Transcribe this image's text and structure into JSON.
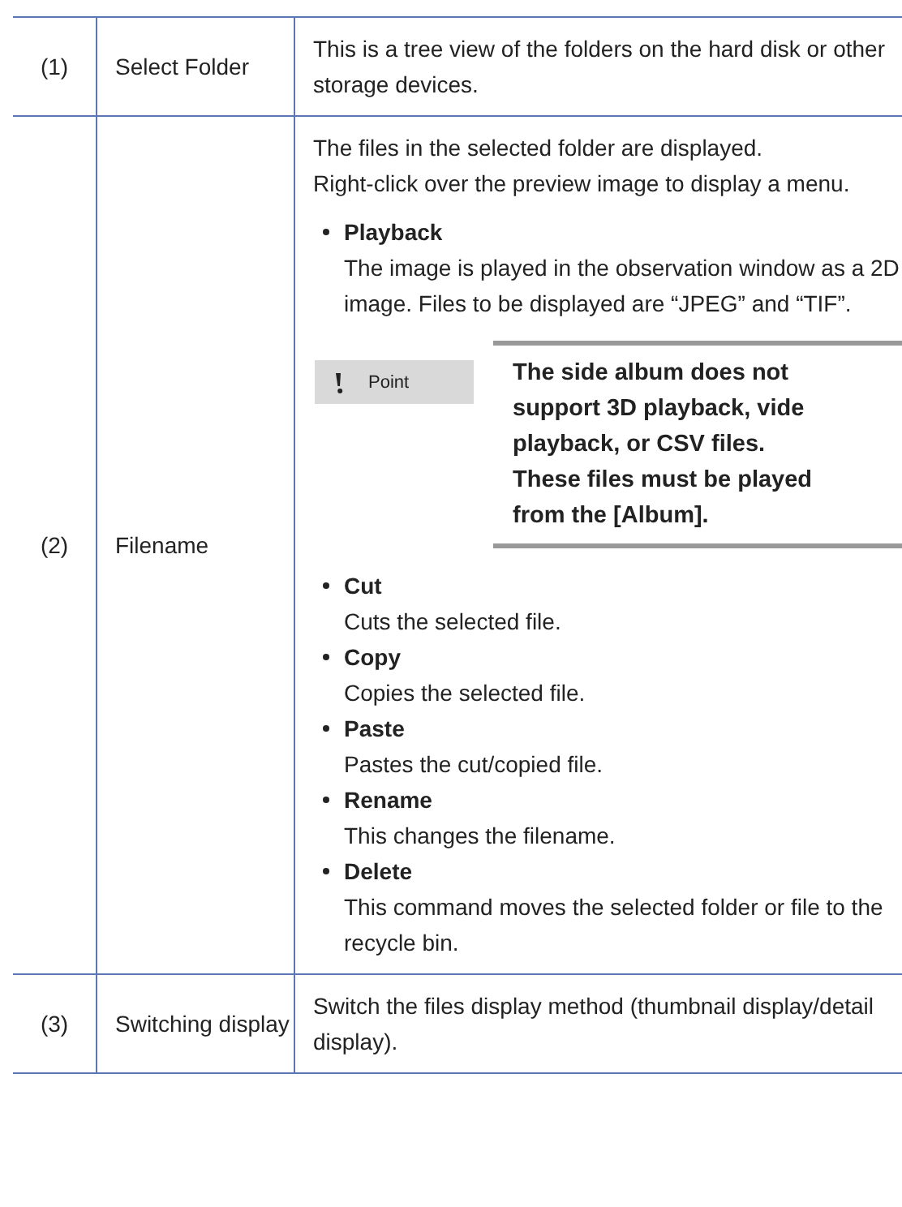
{
  "rows": [
    {
      "number": "(1)",
      "item": "Select Folder",
      "paragraphs": [
        "This is a tree view of the folders on the hard disk or other storage devices."
      ],
      "commands": []
    },
    {
      "number": "(2)",
      "item": "Filename",
      "paragraphs": [
        "The files in the selected folder are displayed.",
        "Right-click over the preview image to display a menu."
      ],
      "commands": [
        {
          "name": "Playback",
          "description": "The image is played in the observation window as a 2D image. Files to be displayed are “JPEG” and “TIF”.",
          "note": {
            "label": "Point",
            "lines": [
              "The side album does not",
              "support 3D playback, vide",
              "playback, or CSV files.",
              "These files must be played",
              "from the [Album]."
            ]
          }
        },
        {
          "name": "Cut",
          "description": "Cuts the selected file."
        },
        {
          "name": "Copy",
          "description": "Copies the selected file."
        },
        {
          "name": "Paste",
          "description": "Pastes the cut/copied file."
        },
        {
          "name": "Rename",
          "description": "This changes the filename."
        },
        {
          "name": "Delete",
          "description": "This command moves the selected folder or file to the recycle bin."
        }
      ]
    },
    {
      "number": "(3)",
      "item": "Switching display",
      "paragraphs": [
        "Switch the files display method (thumbnail display/detail display)."
      ],
      "commands": []
    }
  ]
}
